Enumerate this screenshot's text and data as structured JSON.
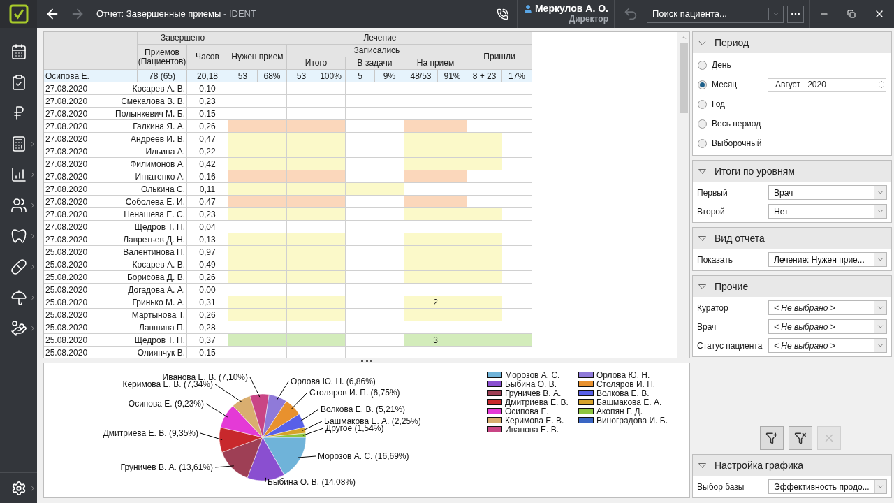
{
  "window": {
    "title": "Отчет: Завершенные приемы",
    "app": " - IDENT",
    "forward_disabled": true
  },
  "user": {
    "name": "Меркулов А. О.",
    "role": "Директор"
  },
  "search": {
    "placeholder": "Поиск пациента..."
  },
  "table": {
    "columns": [
      {
        "label": "Завершено",
        "children": [
          {
            "label": "Приемов (Пациентов)"
          },
          {
            "label": "Часов"
          }
        ]
      },
      {
        "label": "Лечение",
        "children": [
          {
            "label": "Нужен прием"
          },
          {
            "label": "Записались",
            "children": [
              {
                "label": "Итого"
              },
              {
                "label": "В задачи"
              },
              {
                "label": "На прием"
              }
            ]
          },
          {
            "label": "Пришли"
          }
        ]
      }
    ],
    "summary": {
      "name": "Осипова Е.",
      "cells": [
        "78 (65)",
        "20,18",
        "53",
        "68%",
        "53",
        "100%",
        "5",
        "9%",
        "48/53",
        "91%",
        "8 + 23",
        "17%"
      ]
    },
    "rows": [
      {
        "date": "27.08.2020",
        "name": "Косарев А. В.",
        "hours": "0,10",
        "cells": [
          {
            "color": "#ffffff"
          },
          {
            "color": "#ffffff"
          },
          {
            "color": "#ffffff"
          },
          {
            "color": "#ffffff"
          },
          {
            "color": "#ffffff"
          },
          {
            "color": "#ffffff"
          }
        ]
      },
      {
        "date": "27.08.2020",
        "name": "Смекалова В. В.",
        "hours": "0,23",
        "cells": [
          {
            "color": "#ffffff"
          },
          {
            "color": "#ffffff"
          },
          {
            "color": "#ffffff"
          },
          {
            "color": "#ffffff"
          },
          {
            "color": "#ffffff"
          },
          {
            "color": "#ffffff"
          }
        ]
      },
      {
        "date": "27.08.2020",
        "name": "Полынкевич М. Б.",
        "hours": "0,15",
        "cells": [
          {
            "color": "#ffffff"
          },
          {
            "color": "#ffffff"
          },
          {
            "color": "#ffffff"
          },
          {
            "color": "#ffffff"
          },
          {
            "color": "#ffffff"
          },
          {
            "color": "#ffffff"
          }
        ]
      },
      {
        "date": "27.08.2020",
        "name": "Галкина Я. А.",
        "hours": "0,26",
        "cells": [
          {
            "color": "#fbd7bb"
          },
          {
            "color": "#fbd7bb"
          },
          {
            "color": "#ffffff"
          },
          {
            "color": "#fbd7bb"
          },
          {
            "color": "#ffffff"
          },
          {
            "color": "#ffffff"
          }
        ]
      },
      {
        "date": "27.08.2020",
        "name": "Андреев И. В.",
        "hours": "0,47",
        "cells": [
          {
            "color": "#fbf9c9"
          },
          {
            "color": "#fbf9c9"
          },
          {
            "color": "#ffffff"
          },
          {
            "color": "#fbf9c9"
          },
          {
            "color": "#fbf9c9"
          },
          {
            "color": "#ffffff"
          }
        ]
      },
      {
        "date": "27.08.2020",
        "name": "Ильина А.",
        "hours": "0,22",
        "cells": [
          {
            "color": "#fbf9c9"
          },
          {
            "color": "#fbf9c9"
          },
          {
            "color": "#ffffff"
          },
          {
            "color": "#fbf9c9"
          },
          {
            "color": "#fbf9c9"
          },
          {
            "color": "#ffffff"
          }
        ]
      },
      {
        "date": "27.08.2020",
        "name": "Филимонов А.",
        "hours": "0,42",
        "cells": [
          {
            "color": "#fbf9c9"
          },
          {
            "color": "#fbf9c9"
          },
          {
            "color": "#ffffff"
          },
          {
            "color": "#fbf9c9"
          },
          {
            "color": "#fbf9c9"
          },
          {
            "color": "#ffffff"
          }
        ]
      },
      {
        "date": "27.08.2020",
        "name": "Игнатенко А.",
        "hours": "0,16",
        "cells": [
          {
            "color": "#fbd7bb"
          },
          {
            "color": "#fbd7bb"
          },
          {
            "color": "#ffffff"
          },
          {
            "color": "#fbd7bb"
          },
          {
            "color": "#ffffff"
          },
          {
            "color": "#ffffff"
          }
        ]
      },
      {
        "date": "27.08.2020",
        "name": "Олькина С.",
        "hours": "0,11",
        "cells": [
          {
            "color": "#fbf9c9"
          },
          {
            "color": "#fbf9c9"
          },
          {
            "color": "#fbf9c9"
          },
          {
            "color": "#ffffff"
          },
          {
            "color": "#ffffff"
          },
          {
            "color": "#ffffff"
          }
        ]
      },
      {
        "date": "27.08.2020",
        "name": "Соболева Е. И.",
        "hours": "0,47",
        "cells": [
          {
            "color": "#fbd7bb"
          },
          {
            "color": "#fbd7bb"
          },
          {
            "color": "#ffffff"
          },
          {
            "color": "#fbd7bb"
          },
          {
            "color": "#ffffff"
          },
          {
            "color": "#ffffff"
          }
        ]
      },
      {
        "date": "27.08.2020",
        "name": "Ненашева Е. С.",
        "hours": "0,23",
        "cells": [
          {
            "color": "#fbf9c9"
          },
          {
            "color": "#fbf9c9"
          },
          {
            "color": "#ffffff"
          },
          {
            "color": "#fbf9c9"
          },
          {
            "color": "#fbf9c9"
          },
          {
            "color": "#ffffff"
          }
        ]
      },
      {
        "date": "27.08.2020",
        "name": "Щедров Т. П.",
        "hours": "0,04",
        "cells": [
          {
            "color": "#ffffff"
          },
          {
            "color": "#ffffff"
          },
          {
            "color": "#ffffff"
          },
          {
            "color": "#ffffff"
          },
          {
            "color": "#ffffff"
          },
          {
            "color": "#ffffff"
          }
        ]
      },
      {
        "date": "27.08.2020",
        "name": "Лавретьев Д. Н.",
        "hours": "0,13",
        "cells": [
          {
            "color": "#fbf9c9"
          },
          {
            "color": "#fbf9c9"
          },
          {
            "color": "#ffffff"
          },
          {
            "color": "#fbf9c9"
          },
          {
            "color": "#fbf9c9"
          },
          {
            "color": "#ffffff"
          }
        ]
      },
      {
        "date": "25.08.2020",
        "name": "Валентинова П.",
        "hours": "0,97",
        "cells": [
          {
            "color": "#fbf9c9"
          },
          {
            "color": "#fbf9c9"
          },
          {
            "color": "#ffffff"
          },
          {
            "color": "#fbf9c9"
          },
          {
            "color": "#fbf9c9"
          },
          {
            "color": "#ffffff"
          }
        ]
      },
      {
        "date": "25.08.2020",
        "name": "Косарев А. В.",
        "hours": "0,49",
        "cells": [
          {
            "color": "#fbf9c9"
          },
          {
            "color": "#fbf9c9"
          },
          {
            "color": "#ffffff"
          },
          {
            "color": "#fbf9c9"
          },
          {
            "color": "#fbf9c9"
          },
          {
            "color": "#ffffff"
          }
        ]
      },
      {
        "date": "25.08.2020",
        "name": "Борисова Д. В.",
        "hours": "0,26",
        "cells": [
          {
            "color": "#fbf9c9"
          },
          {
            "color": "#fbf9c9"
          },
          {
            "color": "#ffffff"
          },
          {
            "color": "#fbf9c9"
          },
          {
            "color": "#fbf9c9"
          },
          {
            "color": "#ffffff"
          }
        ]
      },
      {
        "date": "25.08.2020",
        "name": "Догадова А. А.",
        "hours": "0,00",
        "cells": [
          {
            "color": "#ffffff"
          },
          {
            "color": "#ffffff"
          },
          {
            "color": "#ffffff"
          },
          {
            "color": "#ffffff"
          },
          {
            "color": "#ffffff"
          },
          {
            "color": "#ffffff"
          }
        ]
      },
      {
        "date": "25.08.2020",
        "name": "Гринько М. А.",
        "hours": "0,31",
        "cells": [
          {
            "color": "#fbf9c9"
          },
          {
            "color": "#fbf9c9"
          },
          {
            "color": "#ffffff"
          },
          {
            "color": "#fbf9c9",
            "text": "2"
          },
          {
            "color": "#fbf9c9"
          },
          {
            "color": "#ffffff"
          }
        ]
      },
      {
        "date": "25.08.2020",
        "name": "Мартынова Т.",
        "hours": "0,26",
        "cells": [
          {
            "color": "#fbf9c9"
          },
          {
            "color": "#fbf9c9"
          },
          {
            "color": "#ffffff"
          },
          {
            "color": "#fbf9c9"
          },
          {
            "color": "#fbf9c9"
          },
          {
            "color": "#ffffff"
          }
        ]
      },
      {
        "date": "25.08.2020",
        "name": "Лапшина П.",
        "hours": "0,28",
        "cells": [
          {
            "color": "#ffffff"
          },
          {
            "color": "#ffffff"
          },
          {
            "color": "#ffffff"
          },
          {
            "color": "#ffffff"
          },
          {
            "color": "#ffffff"
          },
          {
            "color": "#ffffff"
          }
        ]
      },
      {
        "date": "25.08.2020",
        "name": "Щедров Т. П.",
        "hours": "0,37",
        "cells": [
          {
            "color": "#d3ecbb"
          },
          {
            "color": "#d3ecbb"
          },
          {
            "color": "#ffffff"
          },
          {
            "color": "#d3ecbb",
            "text": "3"
          },
          {
            "color": "#d3ecbb"
          },
          {
            "color": "#d3ecbb"
          }
        ]
      },
      {
        "date": "25.08.2020",
        "name": "Олиянчук В.",
        "hours": "0,15",
        "cells": [
          {
            "color": "#ffffff"
          },
          {
            "color": "#ffffff"
          },
          {
            "color": "#ffffff"
          },
          {
            "color": "#ffffff"
          },
          {
            "color": "#ffffff"
          },
          {
            "color": "#ffffff"
          }
        ]
      }
    ]
  },
  "chart": {
    "chart_data": {
      "type": "pie",
      "categories": [
        "Морозов А. С.",
        "Быбина О. В.",
        "Груничев В. А.",
        "Дмитриева Е. В.",
        "Осипова Е.",
        "Керимова Е. В.",
        "Иванова Е. В.",
        "Орлова Ю. Н.",
        "Столяров И. П.",
        "Волкова Е. В.",
        "Башмакова Е. А.",
        "Другое"
      ],
      "values": [
        16.69,
        14.08,
        13.61,
        9.35,
        9.23,
        7.34,
        7.1,
        6.86,
        6.75,
        5.21,
        2.25,
        1.54
      ],
      "colors": [
        "#6fb3d9",
        "#8a4fd0",
        "#9e3f55",
        "#c8282c",
        "#e43ad6",
        "#d9ae6f",
        "#c94585",
        "#8f7ad9",
        "#e8912e",
        "#5860e8",
        "#d6a32a",
        "#8ec63f"
      ],
      "value_labels": [
        "(16,69%)",
        "(14,08%)",
        "(13,61%)",
        "(9,35%)",
        "(9,23%)",
        "(7,34%)",
        "(7,10%)",
        "(6,86%)",
        "(6,75%)",
        "(5,21%)",
        "(2,25%)",
        "(1,54%)"
      ]
    },
    "legend": [
      {
        "label": "Морозов А. С.",
        "color": "#6fb3d9"
      },
      {
        "label": "Быбина О. В.",
        "color": "#8a4fd0"
      },
      {
        "label": "Груничев В. А.",
        "color": "#9e3f55"
      },
      {
        "label": "Дмитриева Е. В.",
        "color": "#c8282c"
      },
      {
        "label": "Осипова Е.",
        "color": "#e43ad6"
      },
      {
        "label": "Керимова Е. В.",
        "color": "#d9ae6f"
      },
      {
        "label": "Иванова Е. В.",
        "color": "#c94585"
      },
      {
        "label": "Орлова Ю. Н.",
        "color": "#8f7ad9"
      },
      {
        "label": "Столяров И. П.",
        "color": "#e8912e"
      },
      {
        "label": "Волкова Е. В.",
        "color": "#5860e8"
      },
      {
        "label": "Башмакова Е. А.",
        "color": "#d6a32a"
      },
      {
        "label": "Акопян Г. Д.",
        "color": "#8ec63f"
      },
      {
        "label": "Виноградова И. Б.",
        "color": "#3a66c4"
      }
    ]
  },
  "period": {
    "title": "Период",
    "options": [
      {
        "label": "День",
        "selected": false
      },
      {
        "label": "Месяц",
        "selected": true,
        "spinner": {
          "month": "Август",
          "year": "2020"
        }
      },
      {
        "label": "Год",
        "selected": false
      },
      {
        "label": "Весь период",
        "selected": false
      },
      {
        "label": "Выборочный",
        "selected": false
      }
    ]
  },
  "sections": [
    {
      "title": "Итоги по уровням",
      "fields": [
        {
          "label": "Первый",
          "value": "Врач",
          "empty": false
        },
        {
          "label": "Второй",
          "value": "Нет",
          "empty": false
        }
      ]
    },
    {
      "title": "Вид отчета",
      "fields": [
        {
          "label": "Показать",
          "value": "Лечение: Нужен прие...",
          "empty": false
        }
      ]
    },
    {
      "title": "Прочие",
      "fields": [
        {
          "label": "Куратор",
          "value": "< Не выбрано >",
          "empty": true
        },
        {
          "label": "Врач",
          "value": "< Не выбрано >",
          "empty": true
        },
        {
          "label": "Статус пациента",
          "value": "< Не выбрано >",
          "empty": true
        }
      ]
    }
  ],
  "filter_buttons": [
    {
      "kind": "add",
      "disabled": false
    },
    {
      "kind": "remove",
      "disabled": false
    },
    {
      "kind": "clear",
      "disabled": true
    }
  ],
  "chart_settings": {
    "title": "Настройка графика",
    "fields": [
      {
        "label": "Выбор базы",
        "value": "Эффективность продо...",
        "empty": false
      }
    ]
  }
}
